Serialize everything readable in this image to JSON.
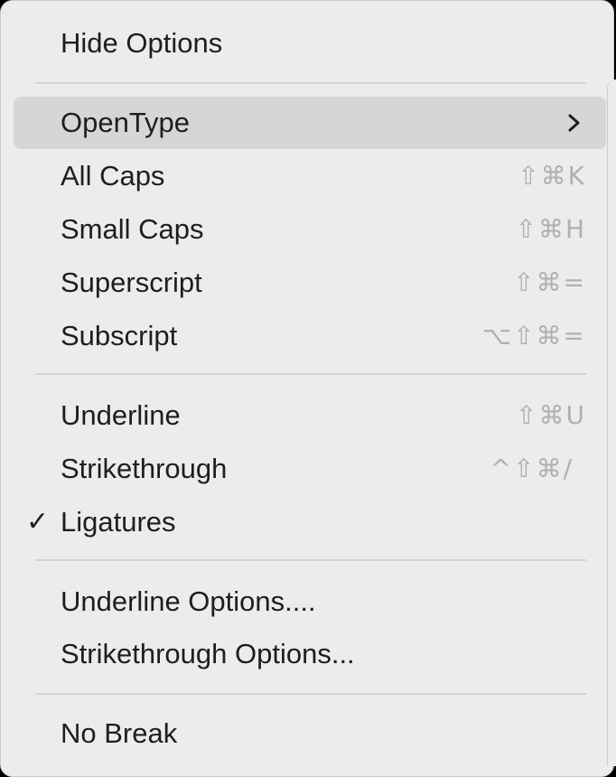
{
  "menu": {
    "items": [
      {
        "label": "Hide Options",
        "shortcut": ""
      },
      {
        "label": "OpenType",
        "shortcut": "",
        "has_submenu": true,
        "highlighted": true
      },
      {
        "label": "All Caps",
        "shortcut": "⇧⌘K"
      },
      {
        "label": "Small Caps",
        "shortcut": "⇧⌘H"
      },
      {
        "label": "Superscript",
        "shortcut": "⇧⌘="
      },
      {
        "label": "Subscript",
        "shortcut": "⌥⇧⌘="
      },
      {
        "label": "Underline",
        "shortcut": "⇧⌘U"
      },
      {
        "label": "Strikethrough",
        "shortcut": "^⇧⌘/"
      },
      {
        "label": "Ligatures",
        "shortcut": "",
        "checked": true
      },
      {
        "label": "Underline Options....",
        "shortcut": ""
      },
      {
        "label": "Strikethrough Options...",
        "shortcut": ""
      },
      {
        "label": "No Break",
        "shortcut": ""
      }
    ],
    "check_glyph": "✓"
  },
  "colors": {
    "menu_background": "#ececec",
    "highlight": "#d6d6d6",
    "text": "#1e1e1e",
    "shortcut_text": "#b0b0b0",
    "separator": "#d4d4d4"
  }
}
